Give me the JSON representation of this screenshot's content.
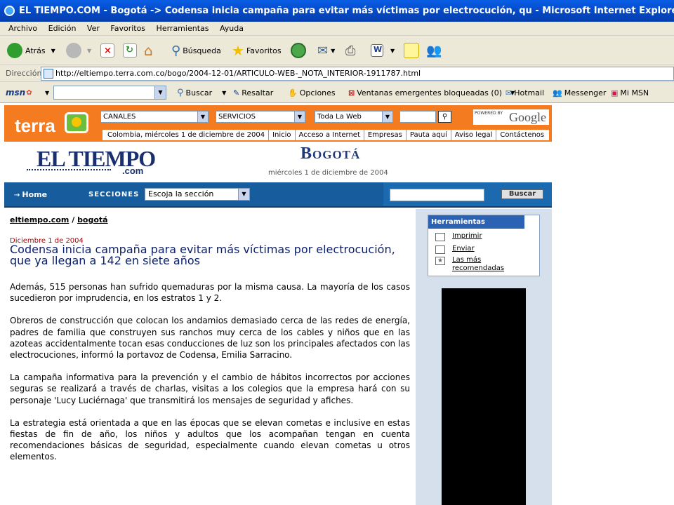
{
  "window": {
    "title": "EL TIEMPO.COM - Bogotá -> Codensa inicia campaña para evitar más víctimas por electrocución, qu - Microsoft Internet Explorer"
  },
  "menu": [
    "Archivo",
    "Edición",
    "Ver",
    "Favoritos",
    "Herramientas",
    "Ayuda"
  ],
  "toolbar": {
    "back": "Atrás",
    "search": "Búsqueda",
    "favorites": "Favoritos"
  },
  "address": {
    "label": "Dirección",
    "url": "http://eltiempo.terra.com.co/bogo/2004-12-01/ARTICULO-WEB-_NOTA_INTERIOR-1911787.html"
  },
  "msn": {
    "logo": "msn",
    "search": "Buscar",
    "highlight": "Resaltar",
    "options": "Opciones",
    "popups": "Ventanas emergentes bloqueadas (0)",
    "hotmail": "Hotmail",
    "messenger": "Messenger",
    "mymsn": "Mi MSN"
  },
  "terra": {
    "logo": "terra",
    "canales": "CANALES",
    "servicios": "SERVICIOS",
    "scope": "Toda La Web",
    "powered": "POWERED BY",
    "google": "Google",
    "nav": [
      "Colombia, miércoles 1 de diciembre de 2004",
      "Inicio",
      "Acceso a Internet",
      "Empresas",
      "Pauta aquí",
      "Aviso legal",
      "Contáctenos"
    ]
  },
  "masthead": {
    "brand": "EL TIEMPO",
    "brand_com": ".com",
    "section": "Bogotá",
    "date": "miércoles 1 de diciembre de 2004"
  },
  "bluebar": {
    "home": "Home",
    "secciones": "SECCIONES",
    "secciones_select": "Escoja la sección",
    "search_button": "Buscar"
  },
  "article": {
    "crumb_site": "eltiempo.com",
    "crumb_sep": "/",
    "crumb_section": "bogotá",
    "date": "Diciembre 1 de 2004",
    "headline": "Codensa inicia campaña para evitar más víctimas por electrocución, que ya llegan a 142 en siete años",
    "paragraphs": [
      "Además, 515 personas han sufrido quemaduras por la misma causa. La mayoría de los casos sucedieron por imprudencia, en los estratos 1 y 2.",
      "Obreros de construcción que colocan los andamios demasiado cerca de las redes de energía, padres de familia que construyen sus ranchos muy cerca de los cables y niños que en las azoteas accidentalmente tocan esas conducciones de luz son los principales afectados con las electrocuciones, informó la portavoz de Codensa, Emilia Sarracino.",
      "La campaña informativa para la prevención y el cambio de hábitos incorrectos por acciones seguras se realizará a través de charlas, visitas a los colegios que la empresa hará con su personaje 'Lucy Luciérnaga' que transmitirá los mensajes de seguridad y afiches.",
      "La estrategia está orientada a que en las épocas que se elevan cometas e inclusive en estas fiestas de fin de año, los niños y adultos que los acompañan tengan en cuenta recomendaciones básicas de seguridad, especialmente cuando elevan cometas u otros elementos."
    ]
  },
  "tools": {
    "title": "Herramientas",
    "print": "Imprimir",
    "send": "Enviar",
    "most_rec_1": "Las más",
    "most_rec_2": "recomendadas"
  }
}
